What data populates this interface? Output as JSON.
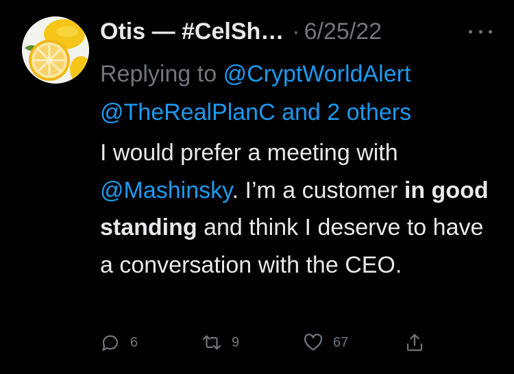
{
  "tweet": {
    "author": "Otis — #CelSh…",
    "separator": "·",
    "date": "6/25/22",
    "replying_prefix": "Replying to",
    "reply_handle_1": "@CryptWorldAlert",
    "reply_handle_2": "@TheRealPlanC",
    "reply_and": "and",
    "reply_others": "2 others",
    "body": {
      "part1": "I would prefer a meeting with ",
      "mention": "@Mashinsky",
      "part2": ". I’m a customer ",
      "bold": "in good standing",
      "part3": " and think I deserve to have a conversation with the CEO."
    }
  },
  "actions": {
    "reply_count": "6",
    "retweet_count": "9",
    "like_count": "67"
  },
  "icons": {
    "avatar": "lemon-avatar",
    "more": "more-options-icon",
    "reply": "reply-icon",
    "retweet": "retweet-icon",
    "like": "heart-icon",
    "share": "share-icon"
  },
  "colors": {
    "background": "#000000",
    "text": "#e7e9ea",
    "muted": "#71767b",
    "link": "#1d9bf0"
  }
}
